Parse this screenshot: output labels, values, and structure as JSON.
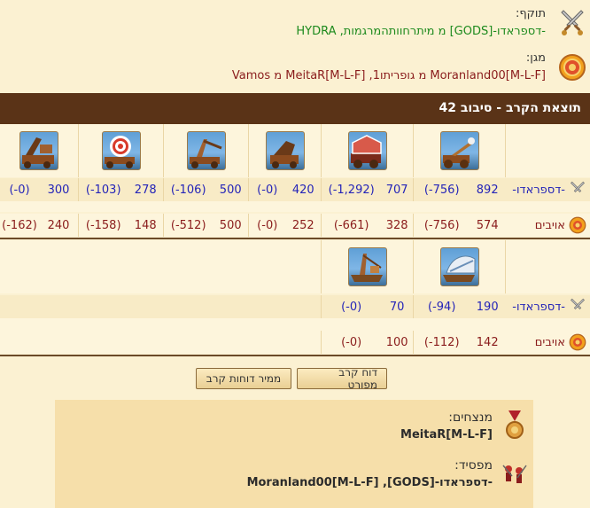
{
  "attacker": {
    "label": "תוקף:",
    "value": "-דספראדו-[GODS] מ מיתרחוותהמרגמות, HYDRA",
    "icon": "crossed-swords-icon"
  },
  "defender": {
    "label": "מגן:",
    "value": "Moranland00[M-L-F] מ גופריתו1, MeitaR[M-L-F] מ Vamos",
    "icon": "shield-icon"
  },
  "battle": {
    "title": "תוצאת הקרב - סיבוב 42"
  },
  "group1": {
    "units": [
      "catapult-unit-icon",
      "ballista-unit-icon",
      "mortar-unit-icon",
      "trebuchet-unit-icon",
      "target-catapult-unit-icon",
      "siege-cannon-unit-icon"
    ],
    "own": {
      "name": "-דספראדו-",
      "values": [
        {
          "count": "892",
          "loss": "(756-)"
        },
        {
          "count": "707",
          "loss": "(1,292-)"
        },
        {
          "count": "420",
          "loss": "(0-)"
        },
        {
          "count": "500",
          "loss": "(106-)"
        },
        {
          "count": "278",
          "loss": "(103-)"
        },
        {
          "count": "300",
          "loss": "(0-)"
        }
      ]
    },
    "enemy": {
      "name": "אויבים",
      "values": [
        {
          "count": "574",
          "loss": "(756-)"
        },
        {
          "count": "328",
          "loss": "(661-)"
        },
        {
          "count": "252",
          "loss": "(0-)"
        },
        {
          "count": "500",
          "loss": "(512-)"
        },
        {
          "count": "148",
          "loss": "(158-)"
        },
        {
          "count": "240",
          "loss": "(162-)"
        }
      ]
    }
  },
  "group2": {
    "units": [
      "steam-ship-unit-icon",
      "crane-ship-unit-icon"
    ],
    "own": {
      "name": "-דספראדו-",
      "values": [
        {
          "count": "190",
          "loss": "(94-)"
        },
        {
          "count": "70",
          "loss": "(0-)"
        }
      ]
    },
    "enemy": {
      "name": "אויבים",
      "values": [
        {
          "count": "142",
          "loss": "(112-)"
        },
        {
          "count": "100",
          "loss": "(0-)"
        }
      ]
    }
  },
  "buttons": {
    "detailed": "דוח קרב מפורט",
    "converter": "ממיר דוחות קרב"
  },
  "summary": {
    "winners_label": "מנצחים:",
    "winners_value": "MeitaR[M-L-F]",
    "losers_label": "מפסיד:",
    "losers_value": "-דספראדו-[GODS], Moranland00[M-L-F]"
  },
  "colors": {
    "header_bg": "#5a3317",
    "attacker_text": "#1d8a1d",
    "defender_text": "#8a1c1c",
    "own_numbers": "#2424b8"
  }
}
